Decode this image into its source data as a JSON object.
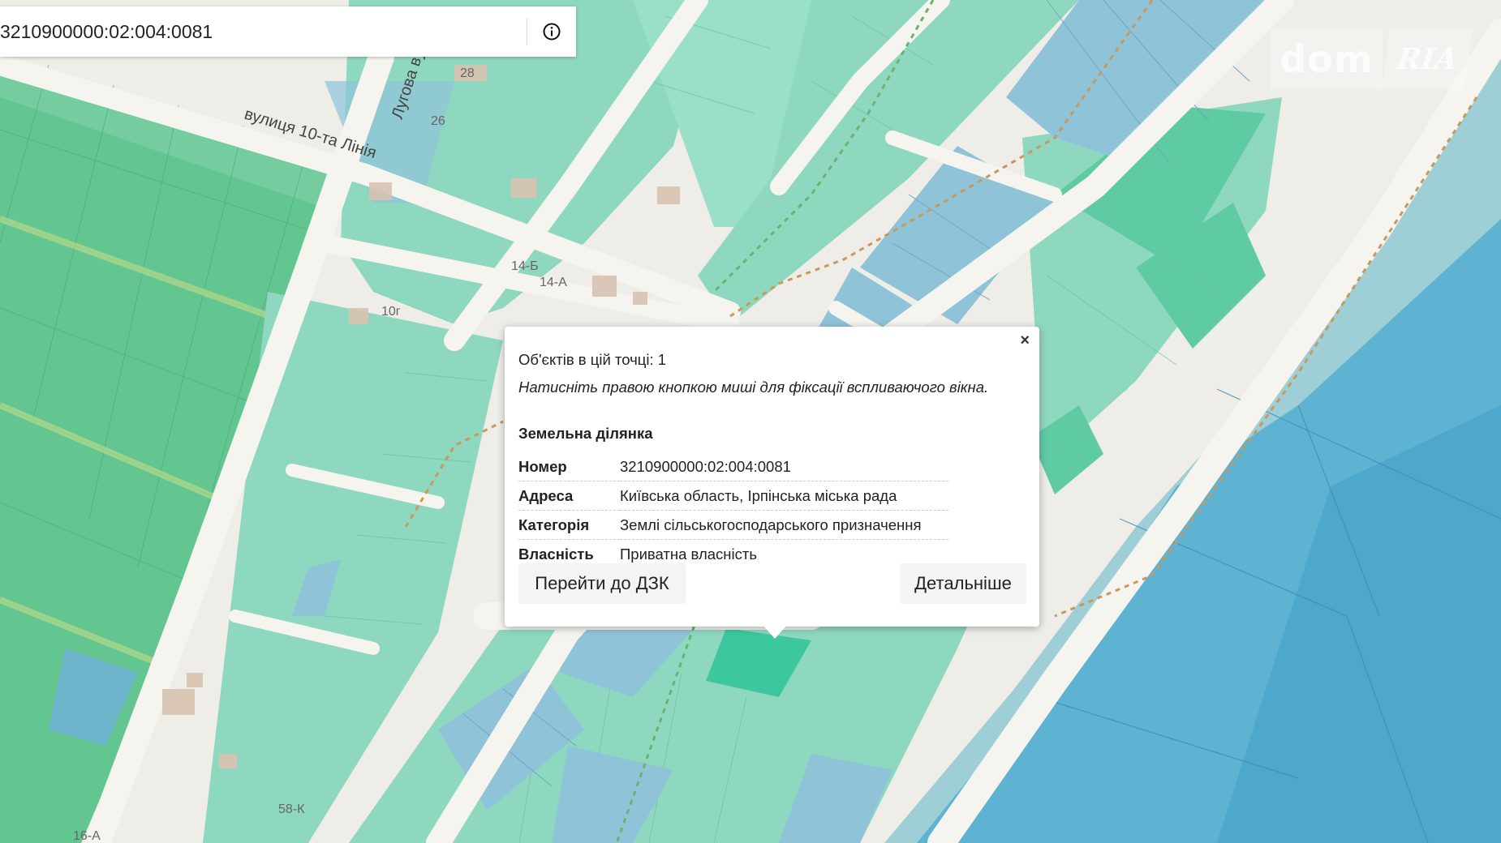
{
  "search": {
    "value": "3210900000:02:004:0081",
    "info_icon": "info-circle-icon"
  },
  "logo": {
    "dom": "dom",
    "ria": "RIA"
  },
  "map_labels": {
    "street_1": "вулиця 10-та Лінія",
    "street_2": "Лугова вул",
    "house_28": "28",
    "house_26": "26",
    "house_14b": "14-Б",
    "house_14a": "14-А",
    "house_10g": "10г",
    "house_58k": "58-К",
    "house_16a": "16-А"
  },
  "popup": {
    "close_label": "×",
    "count_text": "Об'єктів в цій точці: 1",
    "hint_text": "Натисніть правою кнопкою миші для фіксації вспливаючого вікна.",
    "section_title": "Земельна ділянка",
    "rows": [
      {
        "key": "Номер",
        "value": "3210900000:02:004:0081"
      },
      {
        "key": "Адреса",
        "value": "Київська область, Ірпінська міська рада"
      },
      {
        "key": "Категорія",
        "value": "Землі сільськогосподарського призначення"
      },
      {
        "key": "Власність",
        "value": "Приватна власність"
      }
    ],
    "btn_dzk": "Перейти до ДЗК",
    "btn_more": "Детальніше"
  },
  "colors": {
    "road": "#f3f1ec",
    "parcel_green": "#7fd3b5",
    "parcel_dark_green": "#5cc49a",
    "parcel_blue": "#8fc3d8",
    "water": "#5eb3d3",
    "highlight": "#3cc79f"
  }
}
